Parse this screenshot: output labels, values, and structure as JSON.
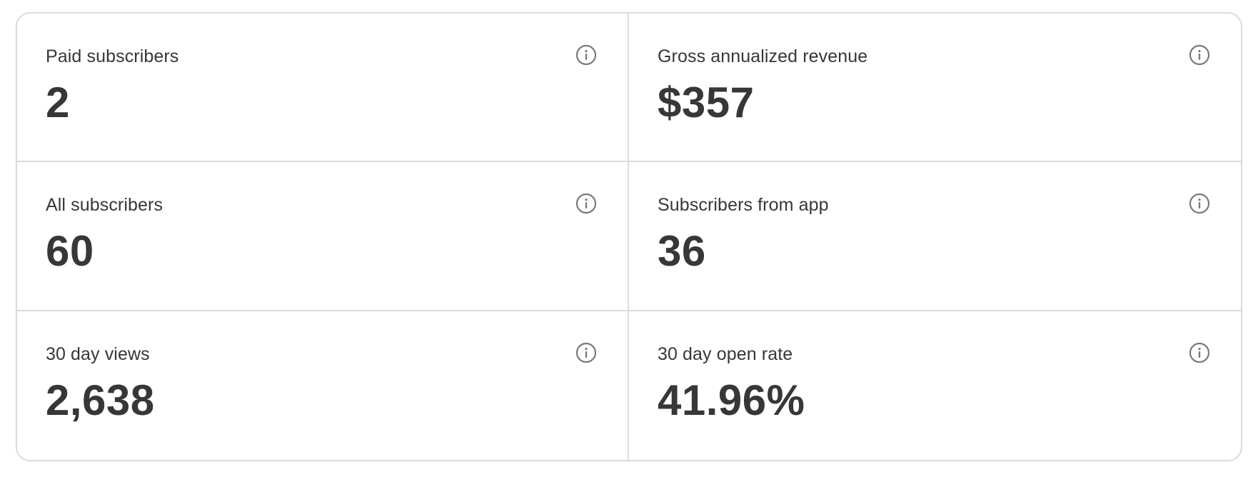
{
  "stats": [
    {
      "label": "Paid subscribers",
      "value": "2",
      "icon": "info-icon"
    },
    {
      "label": "Gross annualized revenue",
      "value": "$357",
      "icon": "info-icon"
    },
    {
      "label": "All subscribers",
      "value": "60",
      "icon": "info-icon"
    },
    {
      "label": "Subscribers from app",
      "value": "36",
      "icon": "info-icon"
    },
    {
      "label": "30 day views",
      "value": "2,638",
      "icon": "info-icon"
    },
    {
      "label": "30 day open rate",
      "value": "41.96%",
      "icon": "info-icon"
    }
  ],
  "colors": {
    "text": "#363737",
    "border": "#dcdcdc",
    "icon": "#7a7a7a",
    "background": "#ffffff"
  }
}
